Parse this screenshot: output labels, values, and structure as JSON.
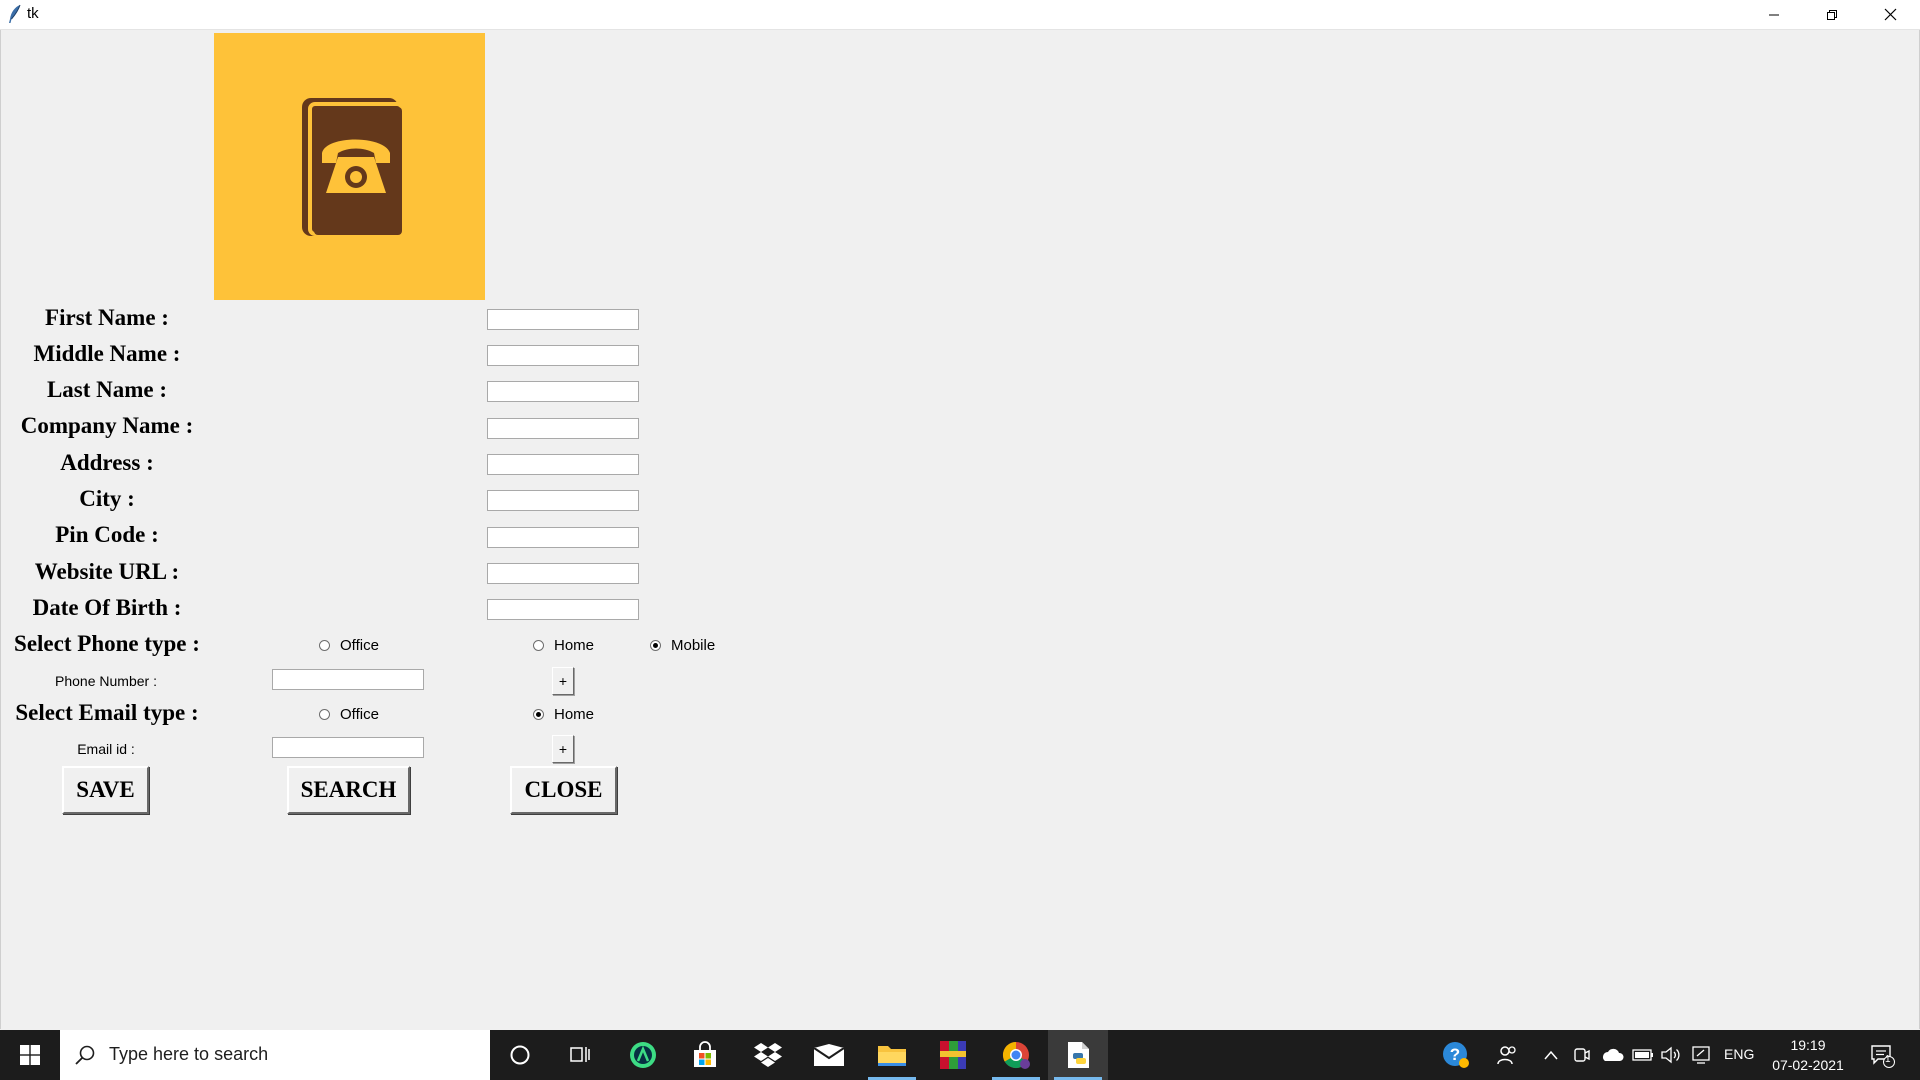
{
  "window": {
    "title": "tk",
    "icon": "feather-icon",
    "controls": [
      "minimize-icon",
      "restore-icon",
      "close-icon"
    ]
  },
  "logo": {
    "icon": "phone-book-icon",
    "background": "#fec239",
    "book_color": "#64381b"
  },
  "form": {
    "fields": [
      {
        "label": "First Name :",
        "value": ""
      },
      {
        "label": "Middle Name :",
        "value": ""
      },
      {
        "label": "Last Name :",
        "value": ""
      },
      {
        "label": "Company Name :",
        "value": ""
      },
      {
        "label": "Address :",
        "value": ""
      },
      {
        "label": "City :",
        "value": ""
      },
      {
        "label": "Pin Code :",
        "value": ""
      },
      {
        "label": "Website URL :",
        "value": ""
      },
      {
        "label": "Date Of Birth :",
        "value": ""
      }
    ],
    "phone_type": {
      "label": "Select Phone type :",
      "options": [
        "Office",
        "Home",
        "Mobile"
      ],
      "selected": "Mobile"
    },
    "phone_number": {
      "label": "Phone Number :",
      "value": "",
      "add_label": "+"
    },
    "email_type": {
      "label": "Select Email type :",
      "options": [
        "Office",
        "Home"
      ],
      "selected": "Home"
    },
    "email_id": {
      "label": "Email id :",
      "value": "",
      "add_label": "+"
    },
    "buttons": {
      "save": "SAVE",
      "search": "SEARCH",
      "close": "CLOSE"
    }
  },
  "taskbar": {
    "search_placeholder": "Type here to search",
    "apps": [
      "cortana-icon",
      "task-view-icon",
      "android-studio-icon",
      "microsoft-store-icon",
      "dropbox-icon",
      "mail-icon",
      "file-explorer-icon",
      "winrar-icon",
      "chrome-icon",
      "python-idle-icon"
    ],
    "tray": [
      "help-icon",
      "people-icon",
      "chevron-up-icon",
      "meet-now-icon",
      "onedrive-icon",
      "battery-icon",
      "volume-icon",
      "network-icon"
    ],
    "language": "ENG",
    "time": "19:19",
    "date": "07-02-2021",
    "notification_count": "1",
    "accent": "#76b9ed"
  }
}
